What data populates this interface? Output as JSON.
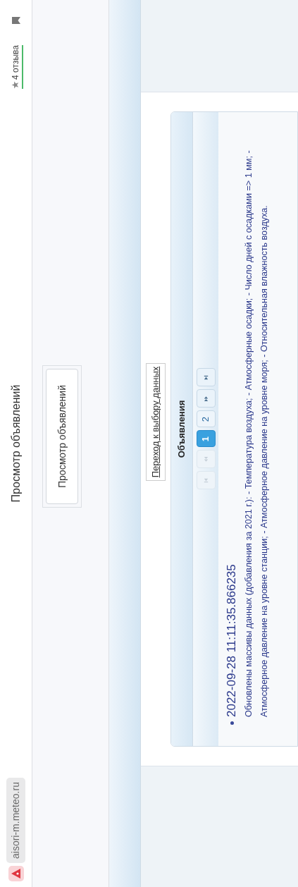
{
  "browser": {
    "url": "aisori-m.meteo.ru",
    "page_title": "Просмотр объявлений",
    "reviews": "4 отзыва"
  },
  "menu": {
    "button": "Просмотр объявлений"
  },
  "link": "Переход к выбору данных",
  "panel": {
    "title": "Объявления",
    "paginator": [
      {
        "kind": "first",
        "disabled": true
      },
      {
        "kind": "prev",
        "disabled": true
      },
      {
        "kind": "page",
        "label": "1",
        "selected": true
      },
      {
        "kind": "page",
        "label": "2",
        "selected": false
      },
      {
        "kind": "next",
        "disabled": false
      },
      {
        "kind": "last",
        "disabled": false
      }
    ],
    "announcements": [
      {
        "date": "2022-09-28 11:11:35.866235",
        "text": "Обновлены массивы данных (добавления за 2021 г.): - Температура воздуха; - Атмосферные осадки; - Число дней с осадками => 1 мм; - Атмосферное давление на уровне станции; - Атмосферное давление на уровне моря; - Относительная влажность воздуха."
      }
    ]
  }
}
